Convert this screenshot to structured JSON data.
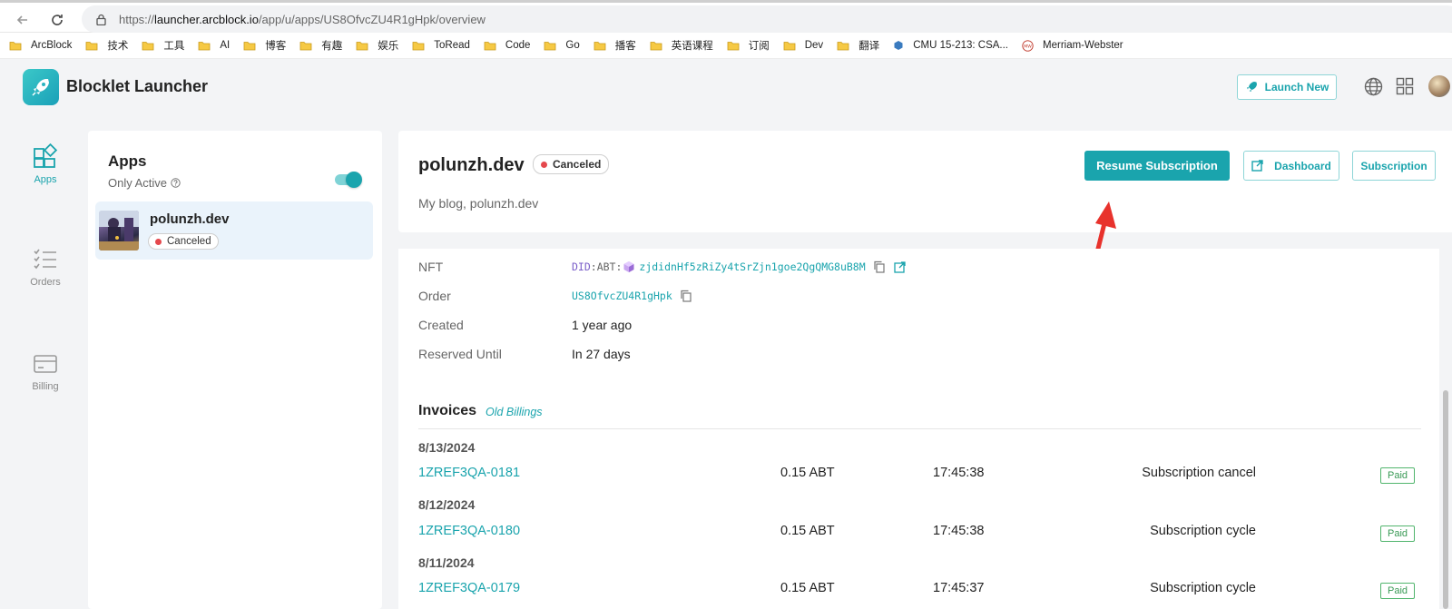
{
  "browser": {
    "url_prefix": "https://",
    "url_host": "launcher.arcblock.io",
    "url_path": "/app/u/apps/US8OfvcZU4R1gHpk/overview"
  },
  "bookmarks": [
    {
      "label": "ArcBlock",
      "icon": "folder-icon"
    },
    {
      "label": "技术",
      "icon": "folder-icon"
    },
    {
      "label": "工具",
      "icon": "folder-icon"
    },
    {
      "label": "AI",
      "icon": "folder-icon"
    },
    {
      "label": "博客",
      "icon": "folder-icon"
    },
    {
      "label": "有趣",
      "icon": "folder-icon"
    },
    {
      "label": "娱乐",
      "icon": "folder-icon"
    },
    {
      "label": "ToRead",
      "icon": "folder-icon"
    },
    {
      "label": "Code",
      "icon": "folder-icon"
    },
    {
      "label": "Go",
      "icon": "folder-icon"
    },
    {
      "label": "播客",
      "icon": "folder-icon"
    },
    {
      "label": "英语课程",
      "icon": "folder-icon"
    },
    {
      "label": "订阅",
      "icon": "folder-icon"
    },
    {
      "label": "Dev",
      "icon": "folder-icon"
    },
    {
      "label": "翻译",
      "icon": "folder-icon"
    },
    {
      "label": "CMU 15-213: CSA...",
      "icon": "site-icon"
    },
    {
      "label": "Merriam-Webster",
      "icon": "site-icon"
    }
  ],
  "header": {
    "brand": "Blocklet Launcher",
    "launch_new": "Launch New"
  },
  "rail": {
    "apps": "Apps",
    "orders": "Orders",
    "billing": "Billing"
  },
  "apps_panel": {
    "title": "Apps",
    "only_active": "Only Active",
    "toggle_on": true,
    "items": [
      {
        "name": "polunzh.dev",
        "status": "Canceled"
      }
    ]
  },
  "app": {
    "name": "polunzh.dev",
    "status": "Canceled",
    "description": "My blog, polunzh.dev",
    "buttons": {
      "resume": "Resume Subscription",
      "dashboard": "Dashboard",
      "subscription": "Subscription"
    }
  },
  "details": {
    "nft_label": "NFT",
    "did_prefix": "DID",
    "did_sep": ":ABT:",
    "did_value": "zjdidnHf5zRiZy4tSrZjn1goe2QgQMG8uB8M",
    "order_label": "Order",
    "order_value": "US8OfvcZU4R1gHpk",
    "created_label": "Created",
    "created_value": "1 year ago",
    "reserved_label": "Reserved Until",
    "reserved_value": "In 27 days"
  },
  "invoices": {
    "title": "Invoices",
    "old_billings": "Old Billings",
    "groups": [
      {
        "date": "8/13/2024",
        "id": "1ZREF3QA-0181",
        "amount": "0.15 ABT",
        "time": "17:45:38",
        "description": "Subscription cancel",
        "status": "Paid"
      },
      {
        "date": "8/12/2024",
        "id": "1ZREF3QA-0180",
        "amount": "0.15 ABT",
        "time": "17:45:38",
        "description": "Subscription cycle",
        "status": "Paid"
      },
      {
        "date": "8/11/2024",
        "id": "1ZREF3QA-0179",
        "amount": "0.15 ABT",
        "time": "17:45:37",
        "description": "Subscription cycle",
        "status": "Paid"
      }
    ]
  },
  "colors": {
    "accent": "#1aa4ad",
    "canceled_dot": "#e5484d",
    "paid": "#3a9a56",
    "arrow": "#e8322c"
  }
}
